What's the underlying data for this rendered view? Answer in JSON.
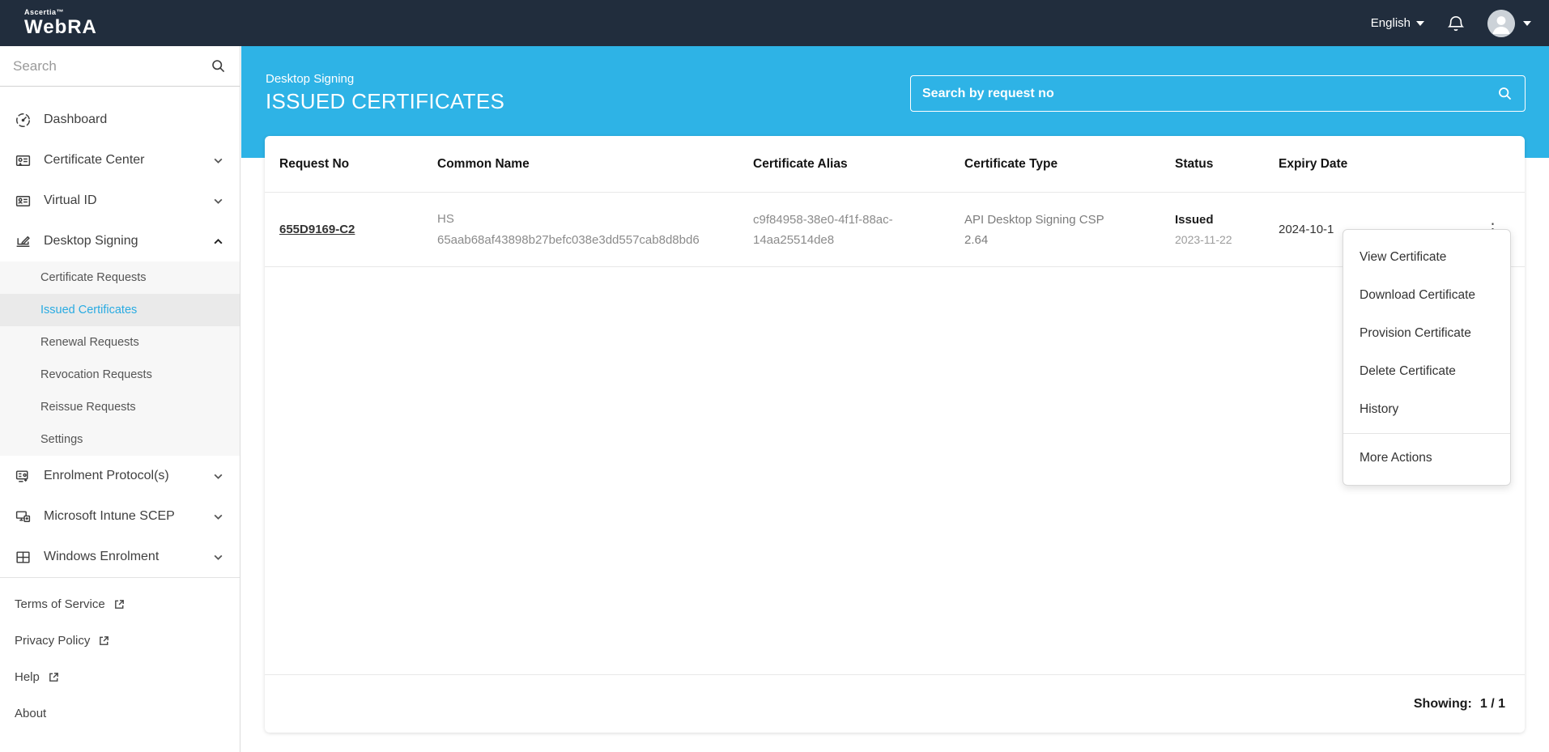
{
  "navbar": {
    "brand_top": "Ascertia™",
    "brand": "WebRA",
    "language": "English"
  },
  "sidebar": {
    "search_placeholder": "Search",
    "items": [
      {
        "label": "Dashboard"
      },
      {
        "label": "Certificate Center"
      },
      {
        "label": "Virtual ID"
      },
      {
        "label": "Desktop Signing"
      },
      {
        "label": "Enrolment Protocol(s)"
      },
      {
        "label": "Microsoft Intune SCEP"
      },
      {
        "label": "Windows Enrolment"
      }
    ],
    "desktop_signing_submenu": {
      "active": "Issued Certificates",
      "items": [
        "Certificate Requests",
        "Issued Certificates",
        "Renewal Requests",
        "Revocation Requests",
        "Reissue Requests",
        "Settings"
      ]
    },
    "footer_links": [
      {
        "label": "Terms of Service",
        "external": true
      },
      {
        "label": "Privacy Policy",
        "external": true
      },
      {
        "label": "Help",
        "external": true
      },
      {
        "label": "About",
        "external": false
      }
    ]
  },
  "page_header": {
    "breadcrumb": "Desktop Signing",
    "title": "ISSUED CERTIFICATES",
    "search_placeholder": "Search by request no"
  },
  "table": {
    "columns": [
      "Request No",
      "Common Name",
      "Certificate Alias",
      "Certificate Type",
      "Status",
      "Expiry Date"
    ],
    "rows": [
      {
        "request_no": "655D9169-C2",
        "common_name_lines": [
          "HS",
          "65aab68af43898b27befc038e3dd557cab8d8bd6"
        ],
        "alias_lines": [
          "c9f84958-38e0-4f1f-88ac-",
          "14aa25514de8"
        ],
        "type_lines": [
          "API Desktop Signing CSP",
          "2.64"
        ],
        "status": "Issued",
        "status_date": "2023-11-22",
        "expiry_date": "2024-10-1"
      }
    ],
    "footer": {
      "showing_label": "Showing:",
      "showing_value": "1 / 1"
    }
  },
  "context_menu": {
    "items": [
      "View Certificate",
      "Download Certificate",
      "Provision Certificate",
      "Delete Certificate",
      "History"
    ],
    "footer_item": "More Actions"
  },
  "colors": {
    "navbar_bg": "#212d3d",
    "accent_cyan": "#2eb3e6",
    "active_link": "#29abe2"
  }
}
